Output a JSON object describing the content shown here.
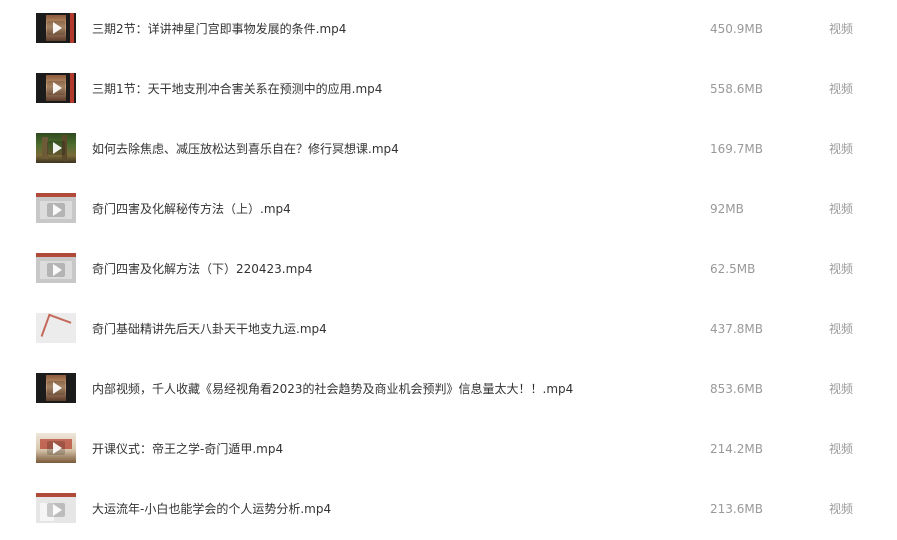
{
  "files": [
    {
      "name": "三期2节：详讲神星门宫即事物发展的条件.mp4",
      "size": "450.9MB",
      "type": "视频",
      "thumb": "dark"
    },
    {
      "name": "三期1节：天干地支刑冲合害关系在预测中的应用.mp4",
      "size": "558.6MB",
      "type": "视频",
      "thumb": "dark"
    },
    {
      "name": "如何去除焦虑、减压放松达到喜乐自在？修行冥想课.mp4",
      "size": "169.7MB",
      "type": "视频",
      "thumb": "forest"
    },
    {
      "name": "奇门四害及化解秘传方法（上）.mp4",
      "size": "92MB",
      "type": "视频",
      "thumb": "gray"
    },
    {
      "name": "奇门四害及化解方法（下）220423.mp4",
      "size": "62.5MB",
      "type": "视频",
      "thumb": "gray"
    },
    {
      "name": "奇门基础精讲先后天八卦天干地支九运.mp4",
      "size": "437.8MB",
      "type": "视频",
      "thumb": "light"
    },
    {
      "name": "内部视频，千人收藏《易经视角看2023的社会趋势及商业机会预判》信息量太大！！.mp4",
      "size": "853.6MB",
      "type": "视频",
      "thumb": "dark"
    },
    {
      "name": "开课仪式：帝王之学-奇门遁甲.mp4",
      "size": "214.2MB",
      "type": "视频",
      "thumb": "room"
    },
    {
      "name": "大运流年-小白也能学会的个人运势分析.mp4",
      "size": "213.6MB",
      "type": "视频",
      "thumb": "light2"
    }
  ]
}
